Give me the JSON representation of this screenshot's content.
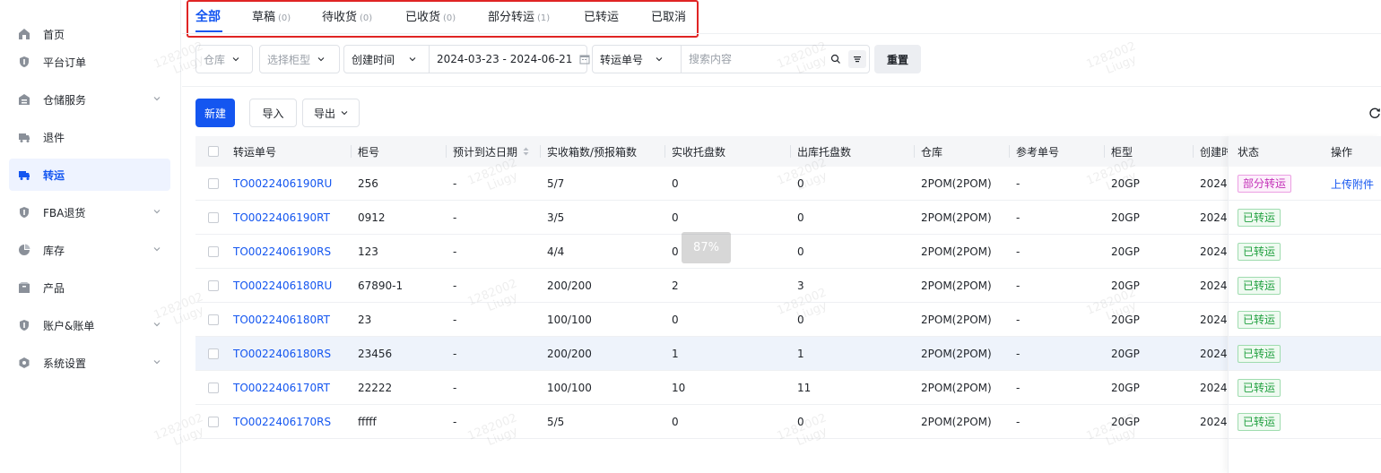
{
  "sidebar": {
    "items": [
      {
        "label": "首页",
        "icon": "home-icon"
      },
      {
        "label": "平台订单",
        "icon": "shield-icon"
      },
      {
        "label": "仓储服务",
        "icon": "warehouse-icon"
      },
      {
        "label": "退件",
        "icon": "truck-icon"
      },
      {
        "label": "转运",
        "icon": "truck-icon"
      },
      {
        "label": "FBA退货",
        "icon": "shield-icon"
      },
      {
        "label": "库存",
        "icon": "pie-chart-icon"
      },
      {
        "label": "产品",
        "icon": "box-icon"
      },
      {
        "label": "账户&账单",
        "icon": "shield-icon"
      },
      {
        "label": "系统设置",
        "icon": "settings-icon"
      }
    ],
    "active_label": "转运",
    "accent": "#1456f0"
  },
  "tabs": [
    {
      "label": "全部",
      "count": ""
    },
    {
      "label": "草稿",
      "count": "(0)"
    },
    {
      "label": "待收货",
      "count": "(0)"
    },
    {
      "label": "已收货",
      "count": "(0)"
    },
    {
      "label": "部分转运",
      "count": "(1)"
    },
    {
      "label": "已转运",
      "count": ""
    },
    {
      "label": "已取消",
      "count": ""
    }
  ],
  "filters": {
    "warehouse": "仓库",
    "cabinet_type": "选择柜型",
    "date_field": "创建时间",
    "date_range": "2024-03-23 - 2024-06-21",
    "search_field": "转运单号",
    "search_placeholder": "搜索内容",
    "reset_label": "重置"
  },
  "toolbar": {
    "new_label": "新建",
    "import_label": "导入",
    "export_label": "导出"
  },
  "table": {
    "columns": [
      "转运单号",
      "柜号",
      "预计到达日期",
      "实收箱数/预报箱数",
      "实收托盘数",
      "出库托盘数",
      "仓库",
      "参考单号",
      "柜型",
      "创建时",
      "状态",
      "操作"
    ],
    "rows": [
      {
        "order_no": "TO0022406190RU",
        "cabinet_no": "256",
        "eta": "-",
        "boxes": "5/7",
        "recv_pallets": "0",
        "out_pallets": "0",
        "warehouse": "2POM(2POM)",
        "ref_no": "-",
        "cabinet_type": "20GP",
        "created": "2024-",
        "status": "部分转运",
        "action": "上传附件"
      },
      {
        "order_no": "TO0022406190RT",
        "cabinet_no": "0912",
        "eta": "-",
        "boxes": "3/5",
        "recv_pallets": "0",
        "out_pallets": "0",
        "warehouse": "2POM(2POM)",
        "ref_no": "-",
        "cabinet_type": "20GP",
        "created": "2024-",
        "status": "已转运",
        "action": ""
      },
      {
        "order_no": "TO0022406190RS",
        "cabinet_no": "123",
        "eta": "-",
        "boxes": "4/4",
        "recv_pallets": "0",
        "out_pallets": "0",
        "warehouse": "2POM(2POM)",
        "ref_no": "-",
        "cabinet_type": "20GP",
        "created": "2024-",
        "status": "已转运",
        "action": ""
      },
      {
        "order_no": "TO0022406180RU",
        "cabinet_no": "67890-1",
        "eta": "-",
        "boxes": "200/200",
        "recv_pallets": "2",
        "out_pallets": "3",
        "warehouse": "2POM(2POM)",
        "ref_no": "-",
        "cabinet_type": "20GP",
        "created": "2024-",
        "status": "已转运",
        "action": ""
      },
      {
        "order_no": "TO0022406180RT",
        "cabinet_no": "23",
        "eta": "-",
        "boxes": "100/100",
        "recv_pallets": "0",
        "out_pallets": "0",
        "warehouse": "2POM(2POM)",
        "ref_no": "-",
        "cabinet_type": "20GP",
        "created": "2024-",
        "status": "已转运",
        "action": ""
      },
      {
        "order_no": "TO0022406180RS",
        "cabinet_no": "23456",
        "eta": "-",
        "boxes": "200/200",
        "recv_pallets": "1",
        "out_pallets": "1",
        "warehouse": "2POM(2POM)",
        "ref_no": "-",
        "cabinet_type": "20GP",
        "created": "2024-",
        "status": "已转运",
        "action": ""
      },
      {
        "order_no": "TO0022406170RT",
        "cabinet_no": "22222",
        "eta": "-",
        "boxes": "100/100",
        "recv_pallets": "10",
        "out_pallets": "11",
        "warehouse": "2POM(2POM)",
        "ref_no": "-",
        "cabinet_type": "20GP",
        "created": "2024-",
        "status": "已转运",
        "action": ""
      },
      {
        "order_no": "TO0022406170RS",
        "cabinet_no": "fffff",
        "eta": "-",
        "boxes": "5/5",
        "recv_pallets": "0",
        "out_pallets": "0",
        "warehouse": "2POM(2POM)",
        "ref_no": "-",
        "cabinet_type": "20GP",
        "created": "2024-",
        "status": "已转运",
        "action": ""
      }
    ]
  },
  "loading": {
    "text": "87%",
    "progress": 0.87
  },
  "watermark": {
    "line1": "1282002",
    "line2": "Liugy"
  },
  "colors": {
    "accent": "#1456f0",
    "tab_highlight": "#e02424",
    "status_partial": "#c32fb7",
    "status_done": "#20a03f"
  }
}
